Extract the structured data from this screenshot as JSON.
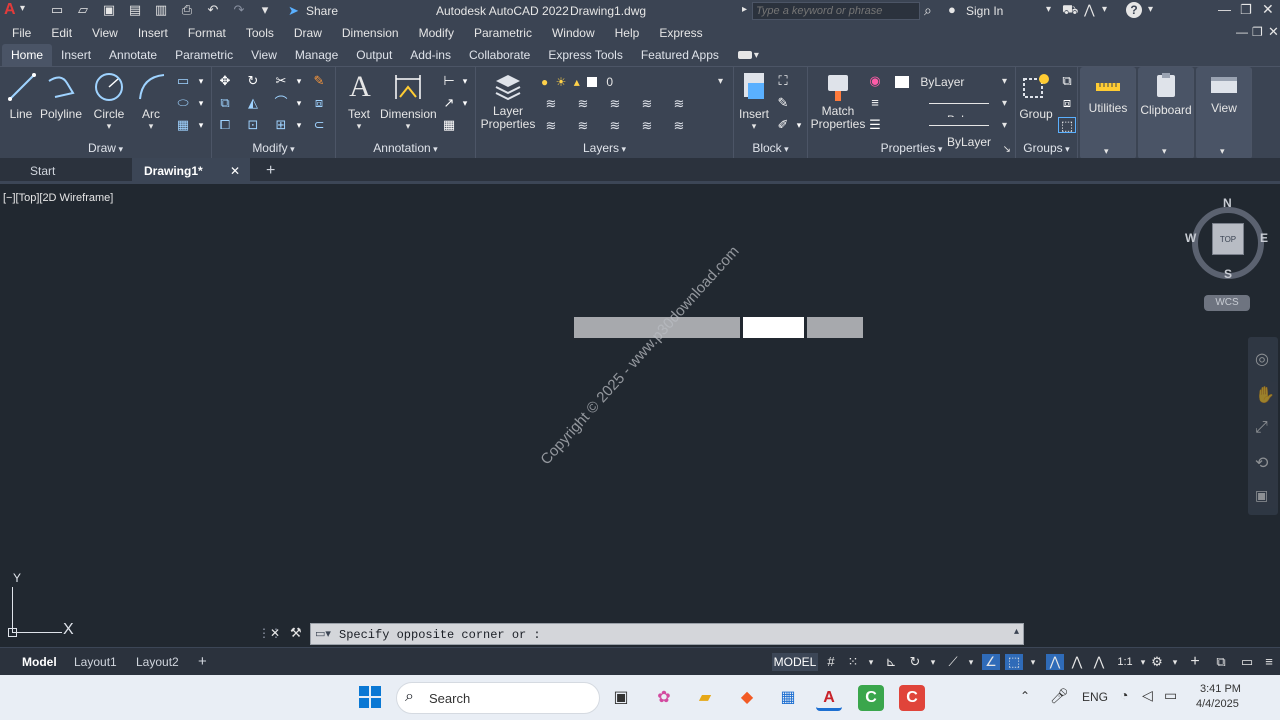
{
  "app": {
    "title": "Autodesk AutoCAD 2022",
    "file": "Drawing1.dwg",
    "share_label": "Share",
    "search_placeholder": "Type a keyword or phrase",
    "sign_in": "Sign In",
    "logo_letter": "A"
  },
  "menu": [
    "File",
    "Edit",
    "View",
    "Insert",
    "Format",
    "Tools",
    "Draw",
    "Dimension",
    "Modify",
    "Parametric",
    "Window",
    "Help",
    "Express"
  ],
  "ribbon_tabs": [
    "Home",
    "Insert",
    "Annotate",
    "Parametric",
    "View",
    "Manage",
    "Output",
    "Add-ins",
    "Collaborate",
    "Express Tools",
    "Featured Apps"
  ],
  "ribbon": {
    "draw": {
      "label": "Draw",
      "line": "Line",
      "polyline": "Polyline",
      "circle": "Circle",
      "arc": "Arc"
    },
    "modify": {
      "label": "Modify"
    },
    "annotation": {
      "label": "Annotation",
      "text": "Text",
      "dimension": "Dimension"
    },
    "layers": {
      "label": "Layers",
      "layer_properties_1": "Layer",
      "layer_properties_2": "Properties",
      "current_layer": "0"
    },
    "block": {
      "label": "Block",
      "insert": "Insert"
    },
    "properties": {
      "label": "Properties",
      "match_1": "Match",
      "match_2": "Properties",
      "color": "ByLayer",
      "linetype": "ByLayer",
      "lineweight": "ByLayer"
    },
    "groups": {
      "label": "Groups",
      "group": "Group"
    },
    "utilities": "Utilities",
    "clipboard": "Clipboard",
    "view": "View"
  },
  "doc_tabs": {
    "start": "Start",
    "active": "Drawing1*"
  },
  "viewport": {
    "label": "[−][Top][2D Wireframe]",
    "compass": {
      "n": "N",
      "s": "S",
      "e": "E",
      "w": "W",
      "top": "TOP",
      "wcs": "WCS"
    },
    "watermark": "Copyright © 2025 - www.p30download.com",
    "ucs": {
      "x": "X",
      "y": "Y"
    }
  },
  "command": {
    "prompt": "Specify opposite corner or :"
  },
  "layout_tabs": [
    "Model",
    "Layout1",
    "Layout2"
  ],
  "status": {
    "model": "MODEL",
    "scale": "1:1"
  },
  "taskbar": {
    "search": "Search",
    "lang": "ENG",
    "time": "3:41 PM",
    "date": "4/4/2025"
  }
}
